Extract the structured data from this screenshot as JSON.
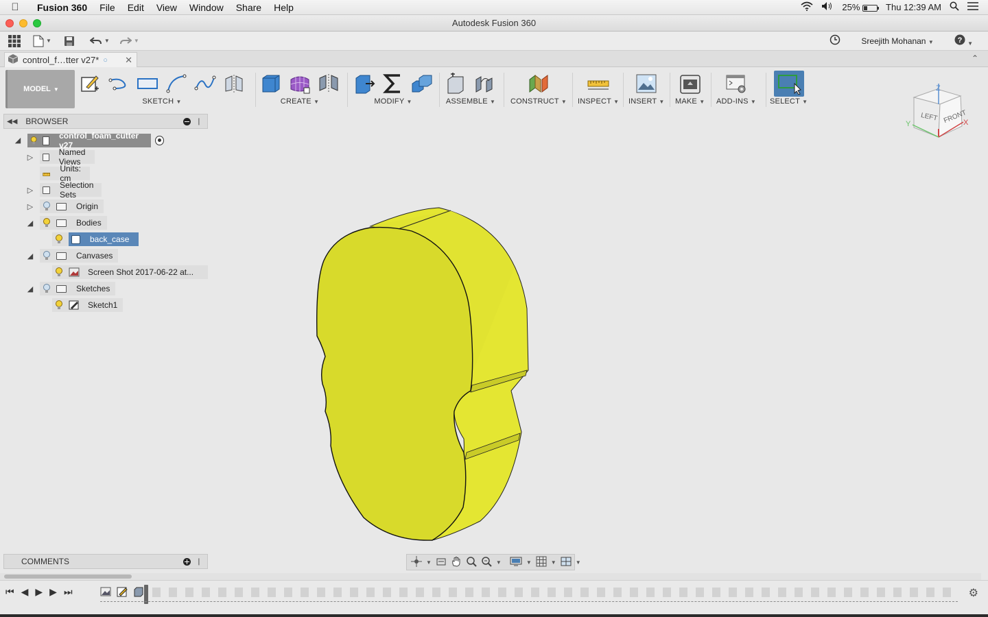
{
  "menubar": {
    "app_name": "Fusion 360",
    "items": [
      "File",
      "Edit",
      "View",
      "Window",
      "Share",
      "Help"
    ],
    "battery": "25%",
    "clock": "Thu 12:39 AM"
  },
  "window": {
    "title": "Autodesk Fusion 360"
  },
  "qat": {
    "user": "Sreejith Mohanan"
  },
  "doc_tab": {
    "label": "control_f…tter v27*"
  },
  "ribbon": {
    "workspace": "MODEL",
    "groups": [
      "SKETCH",
      "CREATE",
      "MODIFY",
      "ASSEMBLE",
      "CONSTRUCT",
      "INSPECT",
      "INSERT",
      "MAKE",
      "ADD-INS",
      "SELECT"
    ]
  },
  "viewcube": {
    "left": "LEFT",
    "front": "FRONT",
    "axis_z": "Z",
    "axis_x": "X",
    "axis_y": "Y"
  },
  "browser": {
    "title": "BROWSER",
    "root": "control_foam_cutter v27",
    "nodes": {
      "named_views": "Named Views",
      "units": "Units: cm",
      "selection_sets": "Selection Sets",
      "origin": "Origin",
      "bodies": "Bodies",
      "back_case": "back_case",
      "canvases": "Canvases",
      "screenshot": "Screen Shot 2017-06-22 at...",
      "sketches": "Sketches",
      "sketch1": "Sketch1"
    }
  },
  "comments": {
    "title": "COMMENTS"
  },
  "colors": {
    "accent": "#5a87b8",
    "body_fill": "#d9dc2c",
    "body_side": "#e4e632"
  }
}
